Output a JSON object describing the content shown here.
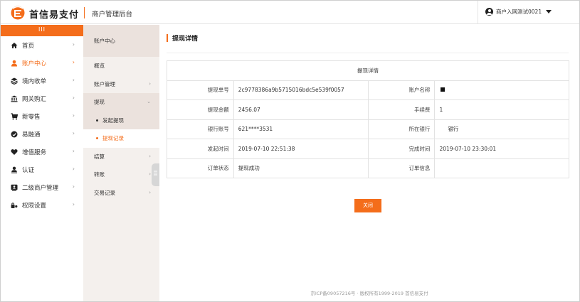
{
  "brand": {
    "name": "首信易支付",
    "accent": "#f46d1b"
  },
  "header": {
    "title": "商户管理后台",
    "user": "商户入网测试0021"
  },
  "sidebar": {
    "toggle": "III",
    "items": [
      {
        "label": "首页",
        "icon": "home-icon"
      },
      {
        "label": "账户中心",
        "icon": "user-icon",
        "active": true
      },
      {
        "label": "境内收单",
        "icon": "layers-icon"
      },
      {
        "label": "网关购汇",
        "icon": "bank-icon"
      },
      {
        "label": "新零售",
        "icon": "cart-icon"
      },
      {
        "label": "易融通",
        "icon": "circle-half-icon"
      },
      {
        "label": "增值服务",
        "icon": "heart-icon"
      },
      {
        "label": "认证",
        "icon": "person-check-icon"
      },
      {
        "label": "二级商户管理",
        "icon": "id-card-icon"
      },
      {
        "label": "权限设置",
        "icon": "key-icon"
      }
    ]
  },
  "subnav": {
    "title": "账户中心",
    "items": [
      {
        "label": "概览"
      },
      {
        "label": "账户管理"
      },
      {
        "label": "提现"
      },
      {
        "label": "发起提现"
      },
      {
        "label": "提现记录"
      },
      {
        "label": "结算"
      },
      {
        "label": "转账"
      },
      {
        "label": "交易记录"
      }
    ]
  },
  "main": {
    "title": "提现详情",
    "table_caption": "提现详情",
    "rows": [
      [
        {
          "label": "提现单号",
          "value": "2c9778386a9b5715016bdc5e539f0057"
        },
        {
          "label": "账户名称",
          "value": ""
        }
      ],
      [
        {
          "label": "提现金额",
          "value": "2456.07"
        },
        {
          "label": "手续费",
          "value": "1"
        }
      ],
      [
        {
          "label": "银行账号",
          "value": "621****3531"
        },
        {
          "label": "所在银行",
          "value": "银行"
        }
      ],
      [
        {
          "label": "发起时间",
          "value": "2019-07-10 22:51:38"
        },
        {
          "label": "完成时间",
          "value": "2019-07-10 23:30:01"
        }
      ],
      [
        {
          "label": "订单状态",
          "value": "提现成功"
        },
        {
          "label": "订单信息",
          "value": ""
        }
      ]
    ],
    "close_label": "关闭",
    "footer": "京ICP备09057216号 · 版权所有1999-2019 首信易支付"
  }
}
